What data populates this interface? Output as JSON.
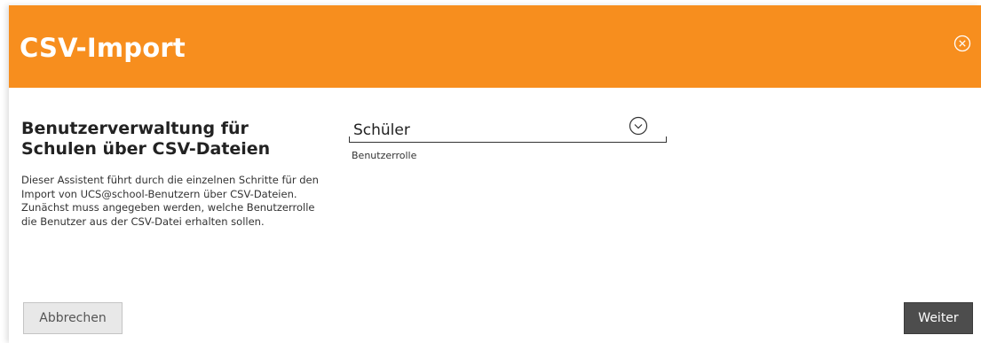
{
  "dialog": {
    "title": "CSV-Import",
    "close_icon": "close-circle-icon",
    "accent_color": "#f78e1e"
  },
  "intro": {
    "heading": "Benutzerverwaltung für Schulen über CSV-Dateien",
    "description": "Dieser Assistent führt durch die einzelnen Schritte für den Import von UCS@school-Benutzern über CSV-Dateien. Zunächst muss angegeben werden, welche Benutzerrolle die Benutzer aus der CSV-Datei erhalten sollen."
  },
  "role_select": {
    "value": "Schüler",
    "label": "Benutzerrolle",
    "icon": "chevron-down-icon"
  },
  "footer": {
    "cancel_label": "Abbrechen",
    "next_label": "Weiter"
  }
}
